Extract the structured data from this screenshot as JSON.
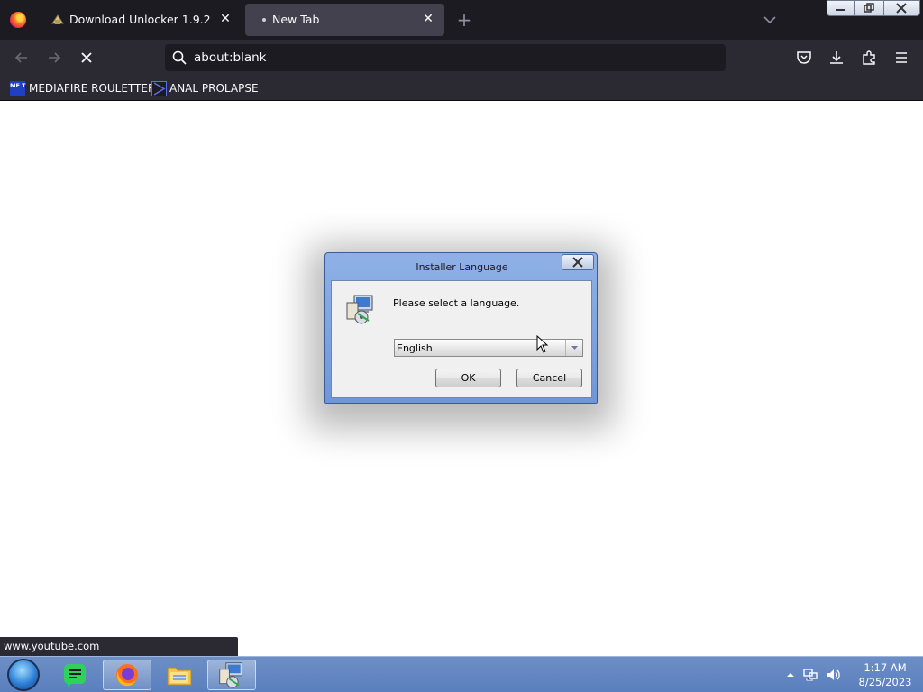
{
  "browser": {
    "tabs": [
      {
        "label": "Download Unlocker 1.9.2",
        "icon": "unlocker-icon",
        "active": false
      },
      {
        "label": "New Tab",
        "icon": "dot-icon",
        "active": true
      }
    ],
    "url": "about:blank",
    "bookmarks": [
      {
        "label": "MEDIAFIRE ROULETTER",
        "icon_text": "MF T"
      },
      {
        "label": "ANAL PROLAPSE"
      }
    ],
    "status_url": "www.youtube.com"
  },
  "dialog": {
    "title": "Installer Language",
    "prompt": "Please select a language.",
    "language": "English",
    "ok_label": "OK",
    "cancel_label": "Cancel"
  },
  "taskbar": {
    "apps": [
      "start-orb-icon",
      "green-notes-icon",
      "firefox-icon",
      "explorer-icon",
      "installer-icon"
    ],
    "clock_time": "1:17 AM",
    "clock_date": "8/25/2023"
  },
  "colors": {
    "tabstrip": "#1c1b22",
    "toolbar": "#2b2a33",
    "active_tab": "#42414d",
    "taskbar": "#5a7fbd",
    "dialog_frame": "#7ea2df"
  }
}
